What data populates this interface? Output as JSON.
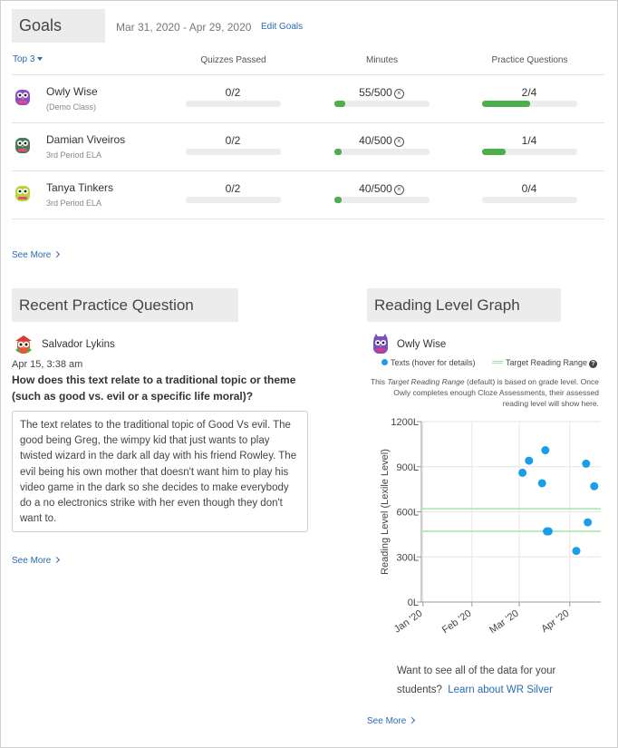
{
  "goals": {
    "title": "Goals",
    "date_range": "Mar 31, 2020 - Apr 29, 2020",
    "edit_label": "Edit Goals",
    "filter_label": "Top 3",
    "columns": [
      "Quizzes Passed",
      "Minutes",
      "Practice Questions"
    ],
    "students": [
      {
        "name": "Owly Wise",
        "class": "(Demo Class)",
        "quizzes": "0/2",
        "quizzes_fraction": 0,
        "minutes": "55/500",
        "minutes_fraction": 0.11,
        "questions": "2/4",
        "questions_fraction": 0.5,
        "avatar_color": "#8a4fc9"
      },
      {
        "name": "Damian Viveiros",
        "class": "3rd Period ELA",
        "quizzes": "0/2",
        "quizzes_fraction": 0,
        "minutes": "40/500",
        "minutes_fraction": 0.08,
        "questions": "1/4",
        "questions_fraction": 0.25,
        "avatar_color": "#4b7a5a"
      },
      {
        "name": "Tanya Tinkers",
        "class": "3rd Period ELA",
        "quizzes": "0/2",
        "quizzes_fraction": 0,
        "minutes": "40/500",
        "minutes_fraction": 0.08,
        "questions": "0/4",
        "questions_fraction": 0,
        "avatar_color": "#b6d63a"
      }
    ],
    "see_more": "See More"
  },
  "recent": {
    "title": "Recent Practice Question",
    "student": "Salvador Lykins",
    "timestamp": "Apr 15, 3:38 am",
    "question": "How does this text relate to a traditional topic or theme (such as good vs. evil or a specific life moral)?",
    "answer": "The text relates to the traditional topic of Good Vs evil. The good being Greg, the wimpy kid that just wants to play twisted wizard in the dark all day with his friend Rowley. The evil being his own mother that doesn't want him to play his video game in the dark so she decides to make everybody do a no electronics strike with her even though they don't want to.",
    "see_more": "See More"
  },
  "reading": {
    "title": "Reading Level Graph",
    "student": "Owly Wise",
    "legend_texts": "Texts (hover for details)",
    "legend_range": "Target Reading Range",
    "note_pre": "This ",
    "note_em": "Target Reading Range",
    "note_post": " (default) is based on grade level. Once Owly completes enough Cloze Assessments, their assessed reading level will show here.",
    "want_text": "Want to see all of the data for your students?",
    "learn_link": "Learn about WR Silver",
    "see_more": "See More"
  },
  "colors": {
    "accent": "#2a6bb0",
    "progress": "#4cae4c",
    "dot": "#1a9ee8",
    "range_line": "#a6e6a6"
  },
  "chart_data": {
    "type": "scatter",
    "title": "",
    "xlabel": "",
    "ylabel": "Reading Level (Lexile Level)",
    "x_ticks": [
      "Jan '20",
      "Feb '20",
      "Mar '20",
      "Apr '20"
    ],
    "xlim": [
      "2020-01-01",
      "2020-04-20"
    ],
    "y_ticks": [
      "0L",
      "300L",
      "600L",
      "900L",
      "1200L"
    ],
    "ylim": [
      0,
      1200
    ],
    "grid": true,
    "legend": "top",
    "series": [
      {
        "name": "Texts (hover for details)",
        "x": [
          "2020-03-03",
          "2020-03-07",
          "2020-03-15",
          "2020-03-17",
          "2020-03-18",
          "2020-03-19",
          "2020-04-05",
          "2020-04-11",
          "2020-04-12",
          "2020-04-16"
        ],
        "y": [
          860,
          940,
          790,
          1010,
          470,
          470,
          340,
          920,
          530,
          770
        ]
      }
    ],
    "target_range": [
      470,
      620
    ]
  }
}
